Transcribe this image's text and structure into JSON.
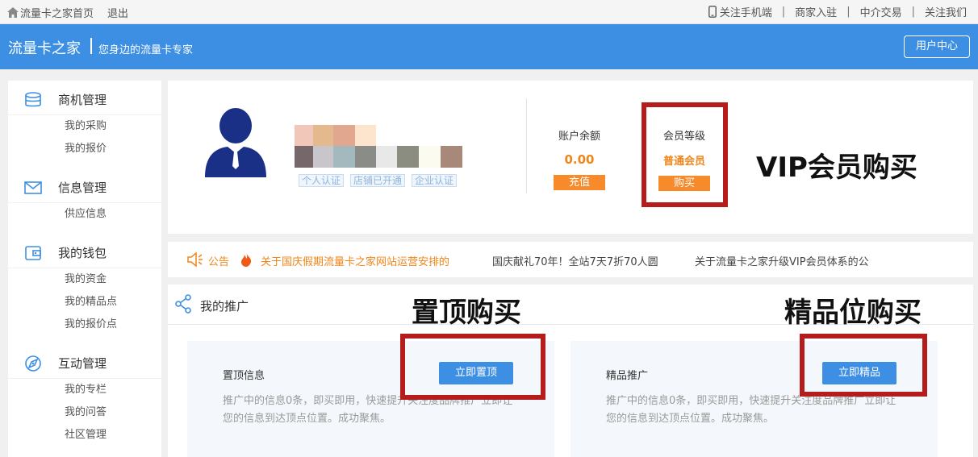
{
  "topbar": {
    "home_link": "流量卡之家首页",
    "logout": "退出",
    "links": [
      "关注手机端",
      "商家入驻",
      "中介交易",
      "关注我们"
    ],
    "separator": "|"
  },
  "header": {
    "brand": "流量卡之家",
    "slogan": "您身边的流量卡专家",
    "user_center": "用户中心"
  },
  "sidebar": {
    "groups": [
      {
        "title": "商机管理",
        "icon": "database-icon",
        "items": [
          "我的采购",
          "我的报价"
        ]
      },
      {
        "title": "信息管理",
        "icon": "mail-icon",
        "items": [
          "供应信息"
        ]
      },
      {
        "title": "我的钱包",
        "icon": "wallet-icon",
        "items": [
          "我的资金",
          "我的精品点",
          "我的报价点"
        ]
      },
      {
        "title": "互动管理",
        "icon": "rocket-icon",
        "items": [
          "我的专栏",
          "我的问答",
          "社区管理"
        ]
      }
    ]
  },
  "profile": {
    "badges": [
      "个人认证",
      "店铺已开通",
      "企业认证"
    ],
    "balance_label": "账户余额",
    "balance_value": "0.00",
    "recharge": "充值",
    "level_label": "会员等级",
    "level_name": "普通会员",
    "buy": "购买"
  },
  "notice": {
    "label": "公告",
    "items": [
      "关于国庆假期流量卡之家网站运营安排的",
      "国庆献礼70年！全站7天7折70人圆",
      "关于流量卡之家升级VIP会员体系的公"
    ]
  },
  "promo": {
    "title": "我的推广",
    "cards": [
      {
        "title": "置顶信息",
        "button": "立即置顶",
        "desc": "推广中的信息0条，即买即用，快速提升关注度品牌推广立即让您的信息到达顶点位置。成功聚焦。"
      },
      {
        "title": "精品推广",
        "button": "立即精品",
        "desc": "推广中的信息0条，即买即用，快速提升关注度品牌推广立即让您的信息到达顶点位置。成功聚焦。"
      }
    ]
  },
  "callouts": {
    "vip": "VIP会员购买",
    "top": "置顶购买",
    "featured": "精品位购买"
  },
  "colors": {
    "header_blue": "#3d8fe3",
    "accent_orange": "#f08519",
    "annotation_red": "#b51d1d"
  }
}
